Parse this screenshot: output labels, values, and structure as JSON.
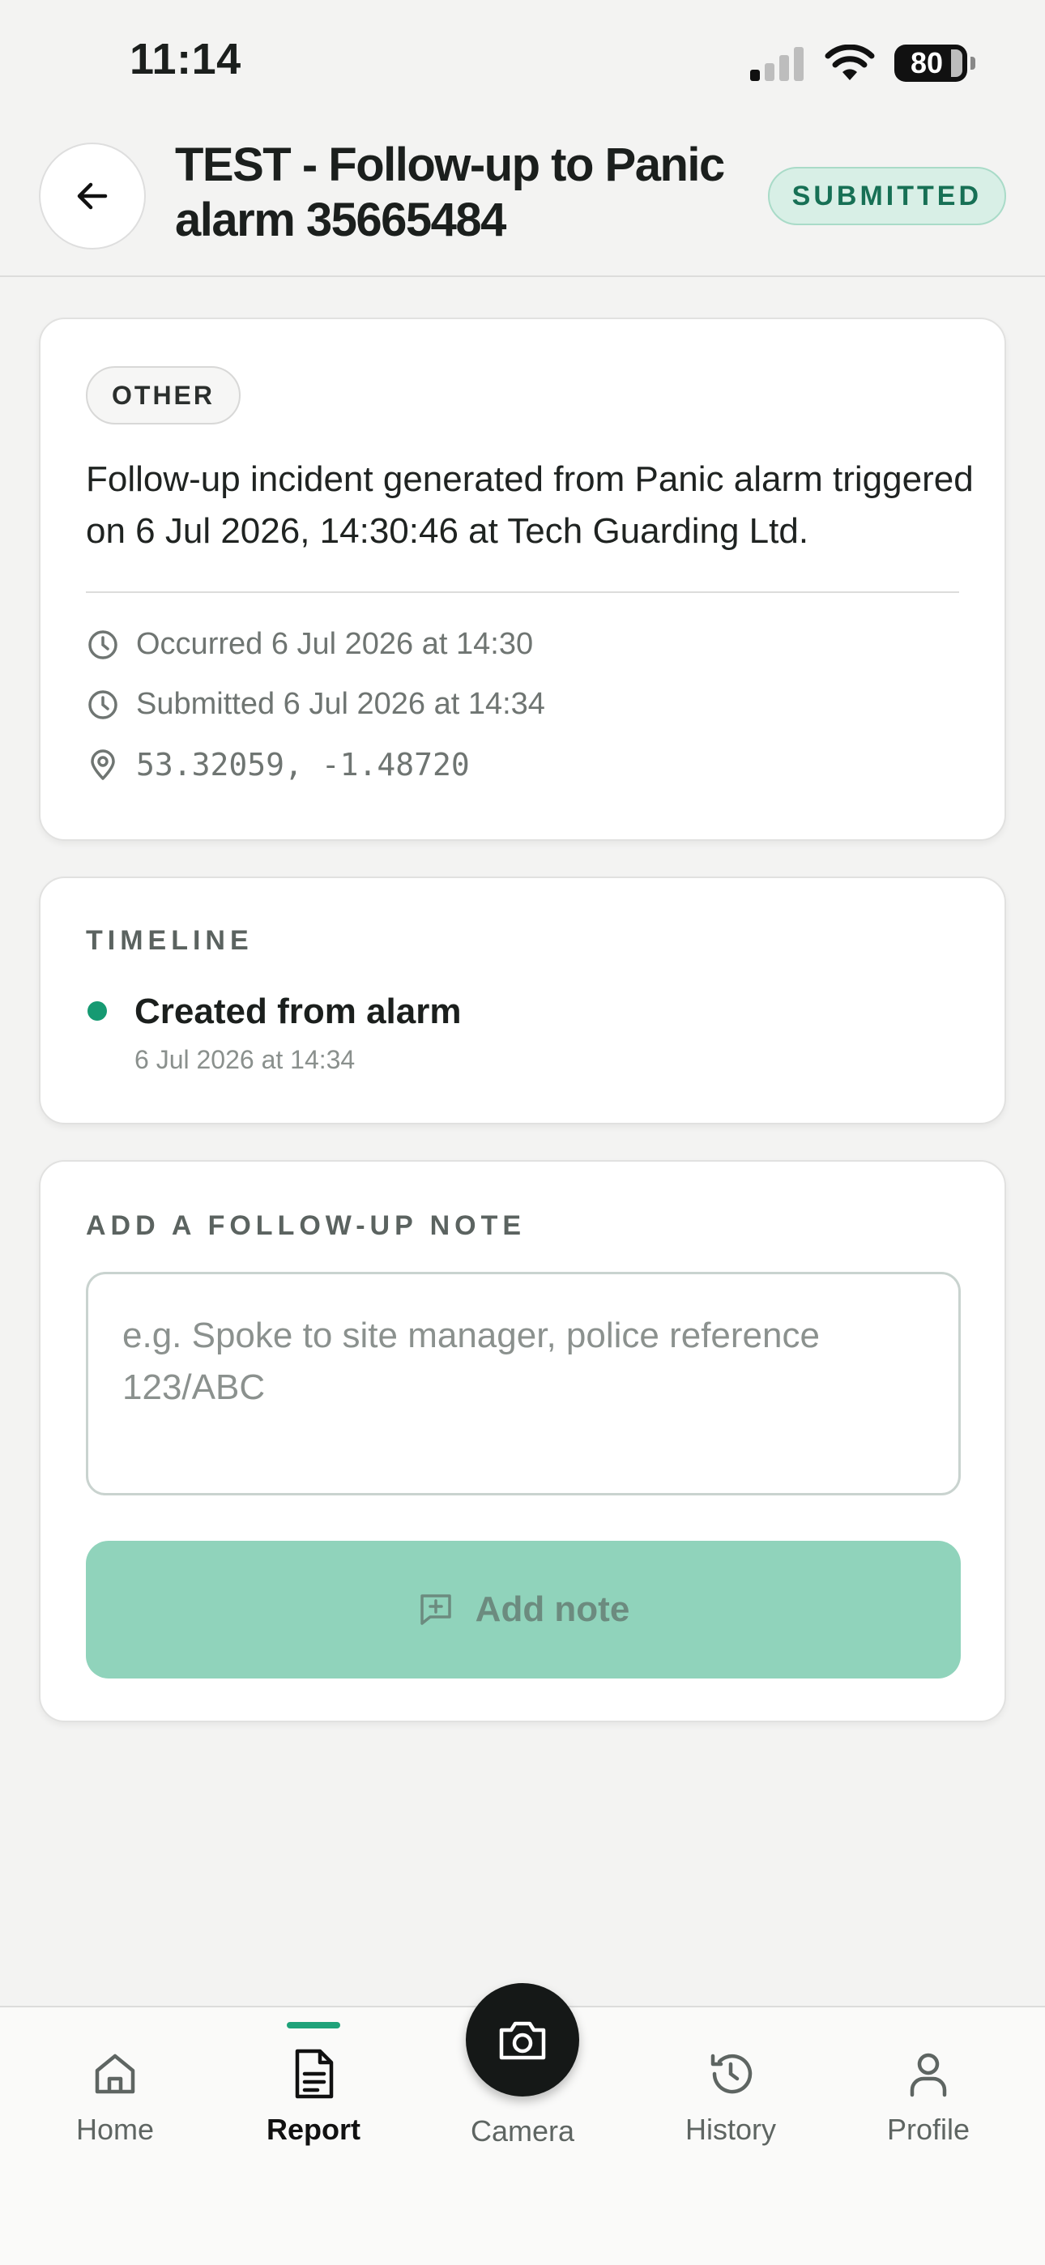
{
  "status_bar": {
    "time": "11:14",
    "battery": "80"
  },
  "header": {
    "title": "TEST - Follow-up to Panic alarm 35665484",
    "status": "SUBMITTED"
  },
  "incident": {
    "category": "OTHER",
    "description": "Follow-up incident generated from Panic alarm triggered on 6 Jul 2026, 14:30:46 at Tech Guarding Ltd.",
    "occurred": "Occurred 6 Jul 2026 at 14:30",
    "submitted": "Submitted 6 Jul 2026 at 14:34",
    "coordinates": "53.32059, -1.48720"
  },
  "timeline": {
    "title": "TIMELINE",
    "items": [
      {
        "label": "Created from alarm",
        "date": "6 Jul 2026 at 14:34"
      }
    ]
  },
  "note": {
    "title": "ADD A FOLLOW-UP NOTE",
    "placeholder": "e.g. Spoke to site manager, police reference 123/ABC",
    "button_label": "Add note"
  },
  "nav": {
    "home": "Home",
    "report": "Report",
    "camera": "Camera",
    "history": "History",
    "profile": "Profile",
    "active": "Report"
  },
  "colors": {
    "accent": "#169a72",
    "button_disabled": "#90d3bb",
    "status_pill_bg": "#d8efe6",
    "status_pill_text": "#177055"
  }
}
